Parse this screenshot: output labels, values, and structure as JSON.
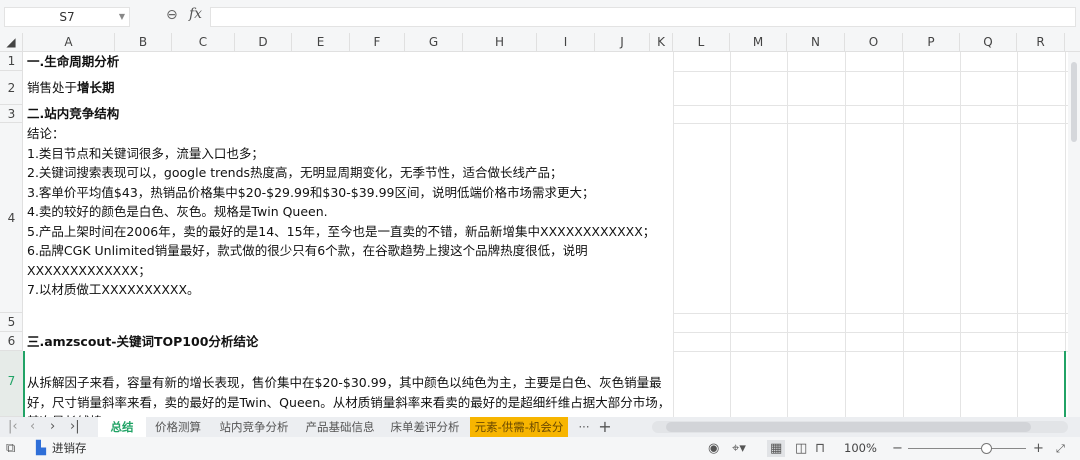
{
  "formula_bar": {
    "cell_ref": "S7",
    "fx_label": "fx",
    "formula": ""
  },
  "columns": [
    "A",
    "B",
    "C",
    "D",
    "E",
    "F",
    "G",
    "H",
    "I",
    "J",
    "K",
    "L",
    "M",
    "N",
    "O",
    "P",
    "Q",
    "R"
  ],
  "rows": [
    "1",
    "2",
    "3",
    "4",
    "5",
    "6",
    "7"
  ],
  "cells": {
    "r1": "一.生命周期分析",
    "r2_prefix": "销售处于",
    "r2_bold": "增长期",
    "r3": "二.站内竞争结构",
    "r4": [
      "结论：",
      "1.类目节点和关键词很多，流量入口也多；",
      "2.关键词搜索表现可以，google trends热度高，无明显周期变化，无季节性，适合做长线产品；",
      "3.客单价平均值$43，热销品价格集中$20-$29.99和$30-$39.99区间，说明低端价格市场需求更大；",
      "4.卖的较好的颜色是白色、灰色。规格是Twin  Queen.",
      "5.产品上架时间在2006年，卖的最好的是14、15年，至今也是一直卖的不错，新品新增集中XXXXXXXXXXXX；",
      "6.品牌CGK Unlimited销量最好，款式做的很少只有6个款，在谷歌趋势上搜这个品牌热度很低，说明",
      "XXXXXXXXXXXXX；",
      "7.以材质做工XXXXXXXXXX。"
    ],
    "r6": "三.amzscout-关键词TOP100分析结论",
    "r7": [
      "从拆解因子来看，容量有新的增长表现，售价集中在$20-$30.99，其中颜色以纯色为主，主要是白色、灰色销量最",
      "好，尺寸销量斜率来看，卖的最好的是Twin、Queen。从材质销量斜率来看卖的最好的是超细纤维占据大部分市场，",
      "其次是长绒棉"
    ]
  },
  "sheet_tabs": [
    {
      "label": "总结",
      "active": true
    },
    {
      "label": "价格测算"
    },
    {
      "label": "站内竞争分析"
    },
    {
      "label": "产品基础信息"
    },
    {
      "label": "床单差评分析"
    },
    {
      "label": "元素-供需-机会分析",
      "highlight": "#f7b500"
    }
  ],
  "tab_more": "···",
  "tab_add": "+",
  "status": {
    "macro_label": "进销存",
    "zoom": "100%",
    "zoom_fraction": 0.67
  },
  "colors": {
    "active_tab": "#21a366",
    "selection": "#21a366"
  }
}
